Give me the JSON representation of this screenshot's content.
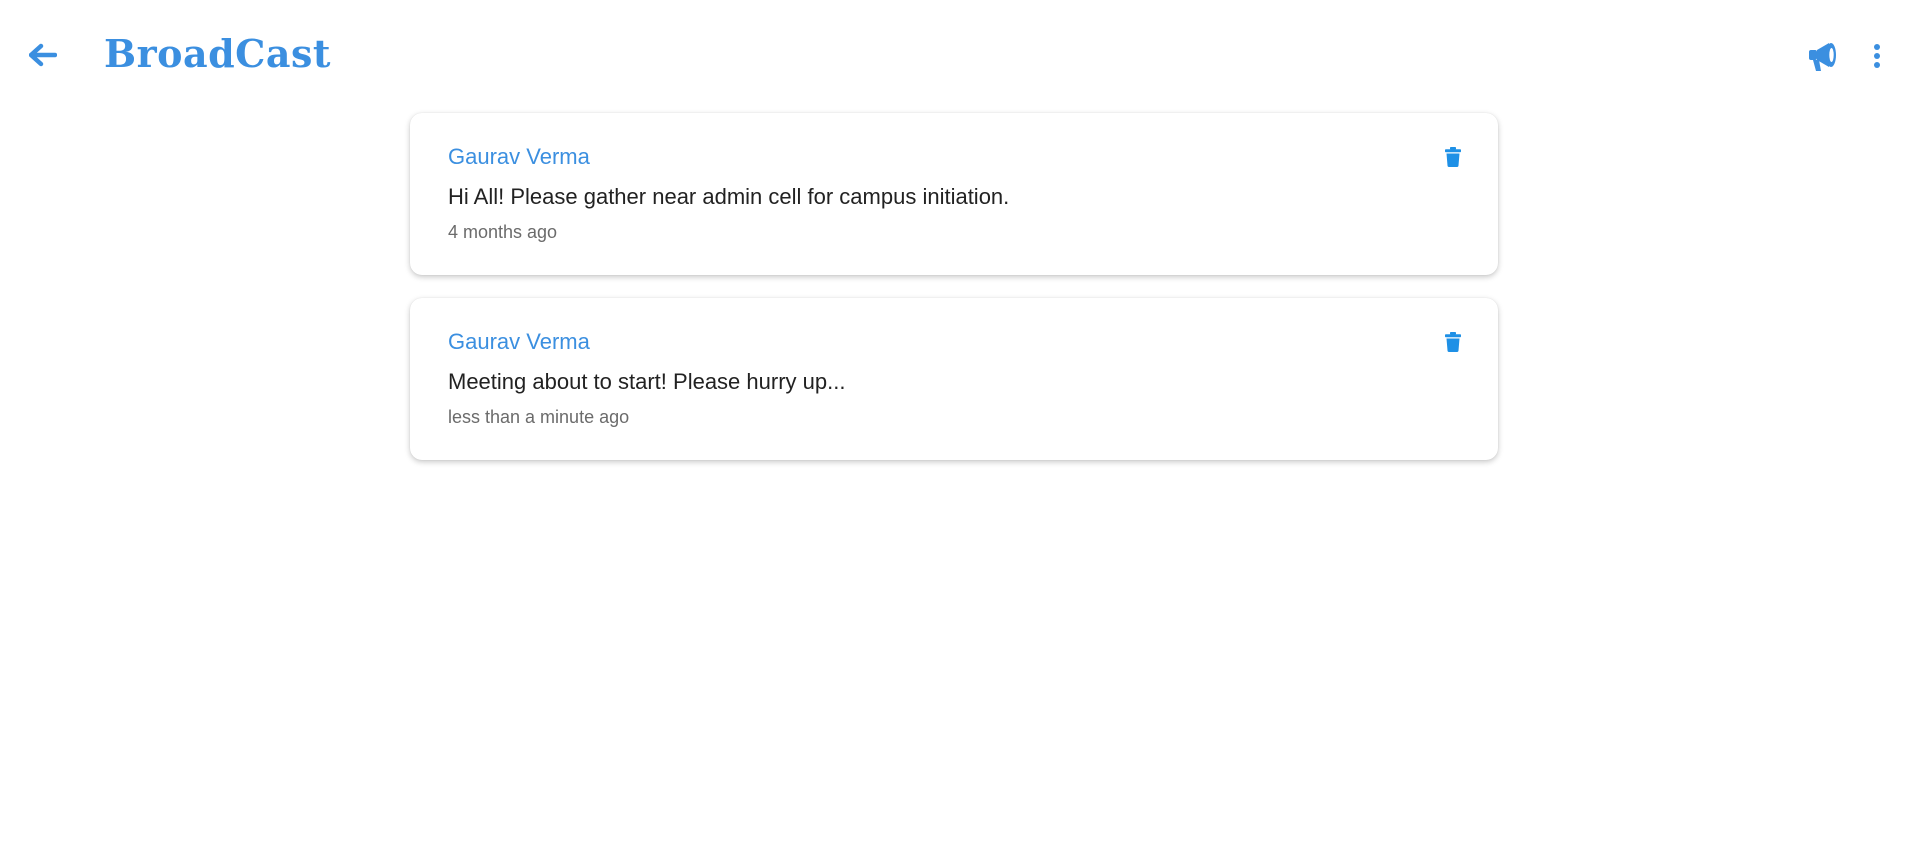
{
  "header": {
    "title": "BroadCast",
    "back_icon": "arrow-left-icon",
    "broadcast_icon": "megaphone-icon",
    "menu_icon": "more-vertical-icon"
  },
  "colors": {
    "accent": "#3b8fe0",
    "delete_icon": "#1e90e6",
    "message_text": "#222222",
    "time_text": "#6b6b6b"
  },
  "messages": [
    {
      "author": "Gaurav Verma",
      "text": "Hi All! Please gather near admin cell for campus initiation.",
      "time": "4 months ago",
      "delete_icon": "trash-icon"
    },
    {
      "author": "Gaurav Verma",
      "text": "Meeting about to start! Please hurry up...",
      "time": "less than a minute ago",
      "delete_icon": "trash-icon"
    }
  ]
}
